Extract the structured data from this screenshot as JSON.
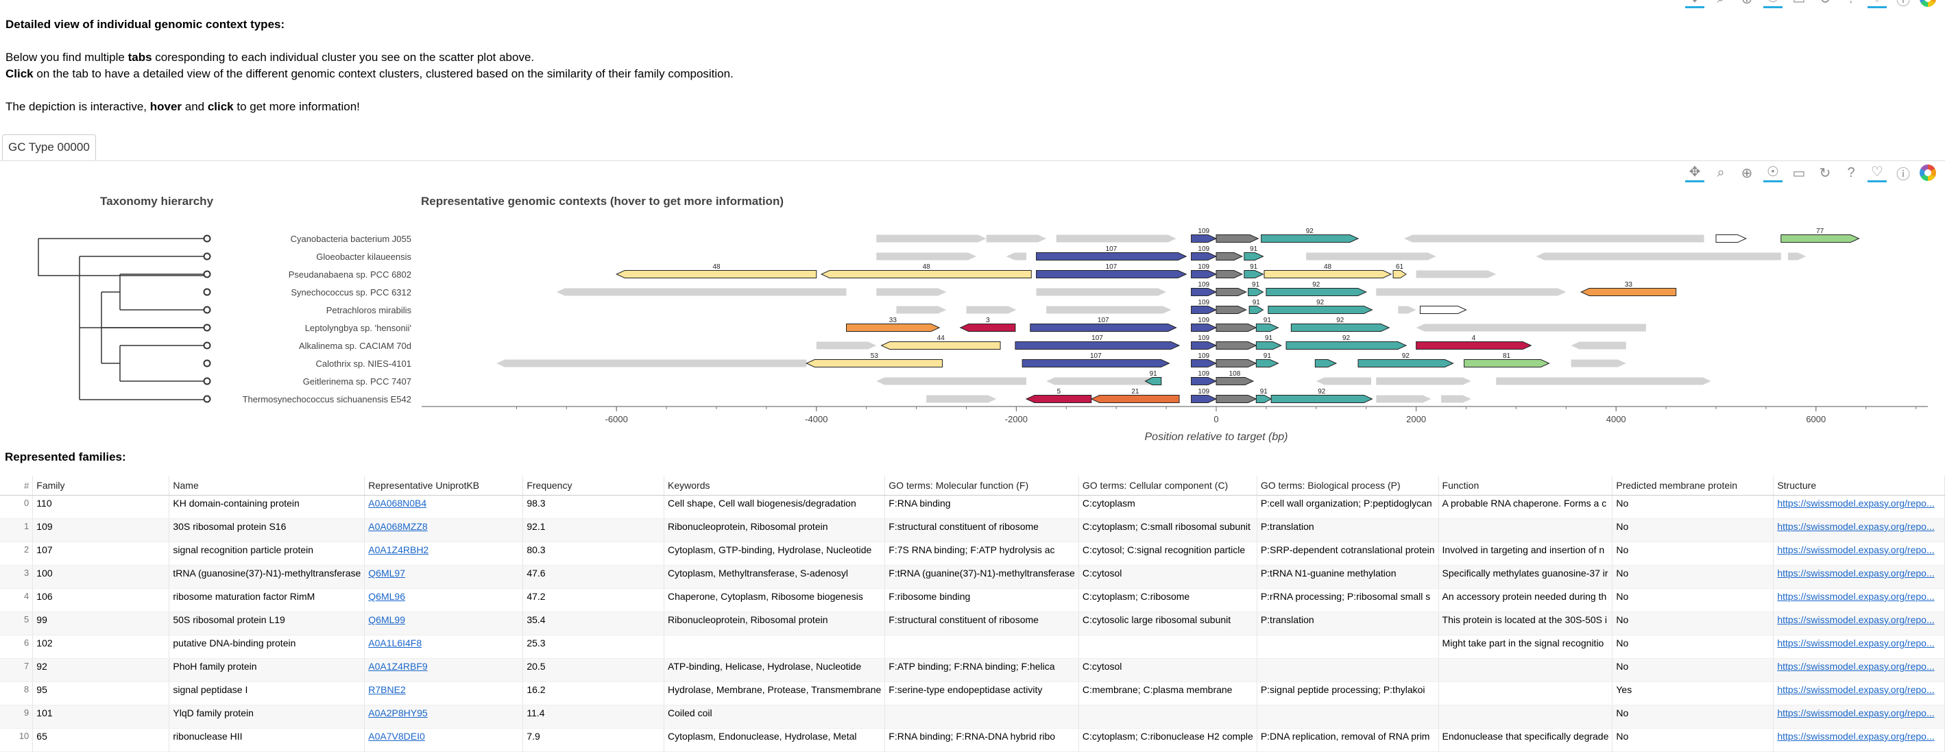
{
  "intro": {
    "title": "Detailed view of individual genomic context types:",
    "line1_pre": "Below you find multiple ",
    "line1_bold": "tabs",
    "line1_post": " coresponding to each individual cluster you see on the scatter plot above.",
    "line2_bold": "Click",
    "line2_post": " on the tab to have a detailed view of the different genomic context clusters, clustered based on the similarity of their family composition.",
    "line3_pre": "The depiction is interactive, ",
    "line3_b1": "hover",
    "line3_mid": " and ",
    "line3_b2": "click",
    "line3_post": " to get more information!"
  },
  "tab": {
    "label": "GC Type 00000"
  },
  "toolbar_icons": [
    "pan-icon",
    "box-zoom-icon",
    "wheel-zoom-icon",
    "tap-icon",
    "save-icon",
    "reset-icon",
    "help-icon",
    "hover-icon",
    "help2-icon",
    "bokeh-logo"
  ],
  "taxonomy": {
    "title": "Taxonomy hierarchy",
    "species": [
      "Cyanobacteria bacterium J055",
      "Gloeobacter kilaueensis",
      "Pseudanabaena sp. PCC 6802",
      "Synechococcus sp. PCC 6312",
      "Petrachloros mirabilis",
      "Leptolyngbya sp. 'hensonii'",
      "Alkalinema sp. CACIAM 70d",
      "Calothrix sp. NIES-4101",
      "Geitlerinema sp. PCC 7407",
      "Thermosynechococcus sichuanensis E542"
    ]
  },
  "contexts": {
    "title": "Representative genomic contexts (hover to get more information)",
    "xlabel": "Position relative to target (bp)",
    "xticks": [
      "-6000",
      "-4000",
      "-2000",
      "0",
      "2000",
      "4000",
      "6000"
    ],
    "colors": {
      "gray": "#d3d3d3",
      "target": "#4a55a8",
      "dark": "#7f7f7f",
      "teal": "#49ada6",
      "yellow": "#fbe59a",
      "orange": "#f29a4a",
      "crimson": "#c3184a",
      "green": "#9ad58a",
      "white": "#ffffff",
      "salmon": "#e8703a"
    }
  },
  "families_title": "Represented families:",
  "table": {
    "headers": [
      "#",
      "Family",
      "Name",
      "Representative UniprotKB",
      "Frequency",
      "Keywords",
      "GO terms: Molecular function (F)",
      "GO terms: Cellular component (C)",
      "GO terms: Biological process (P)",
      "Function",
      "Predicted membrane protein",
      "Structure"
    ],
    "rows": [
      [
        "0",
        "110",
        "KH domain-containing protein",
        "A0A068N0B4",
        "98.3",
        "Cell shape, Cell wall biogenesis/degradation",
        "F:RNA binding",
        "C:cytoplasm",
        "P:cell wall organization; P:peptidoglycan",
        "A probable RNA chaperone. Forms a c",
        "No",
        "https://swissmodel.expasy.org/repo..."
      ],
      [
        "1",
        "109",
        "30S ribosomal protein S16",
        "A0A068MZZ8",
        "92.1",
        "Ribonucleoprotein, Ribosomal protein",
        "F:structural constituent of ribosome",
        "C:cytoplasm; C:small ribosomal subunit",
        "P:translation",
        "",
        "No",
        "https://swissmodel.expasy.org/repo..."
      ],
      [
        "2",
        "107",
        "signal recognition particle protein",
        "A0A1Z4RBH2",
        "80.3",
        "Cytoplasm, GTP-binding, Hydrolase, Nucleotide",
        "F:7S RNA binding; F:ATP hydrolysis ac",
        "C:cytosol; C:signal recognition particle",
        "P:SRP-dependent cotranslational protein",
        "Involved in targeting and insertion of n",
        "No",
        "https://swissmodel.expasy.org/repo..."
      ],
      [
        "3",
        "100",
        "tRNA (guanosine(37)-N1)-methyltransferase",
        "Q6ML97",
        "47.6",
        "Cytoplasm, Methyltransferase, S-adenosyl",
        "F:tRNA (guanine(37)-N1)-methyltransferase",
        "C:cytosol",
        "P:tRNA N1-guanine methylation",
        "Specifically methylates guanosine-37 ir",
        "No",
        "https://swissmodel.expasy.org/repo..."
      ],
      [
        "4",
        "106",
        "ribosome maturation factor RimM",
        "Q6ML96",
        "47.2",
        "Chaperone, Cytoplasm, Ribosome biogenesis",
        "F:ribosome binding",
        "C:cytoplasm; C:ribosome",
        "P:rRNA processing; P:ribosomal small s",
        "An accessory protein needed during th",
        "No",
        "https://swissmodel.expasy.org/repo..."
      ],
      [
        "5",
        "99",
        "50S ribosomal protein L19",
        "Q6ML99",
        "35.4",
        "Ribonucleoprotein, Ribosomal protein",
        "F:structural constituent of ribosome",
        "C:cytosolic large ribosomal subunit",
        "P:translation",
        "This protein is located at the 30S-50S i",
        "No",
        "https://swissmodel.expasy.org/repo..."
      ],
      [
        "6",
        "102",
        "putative DNA-binding protein",
        "A0A1L6I4F8",
        "25.3",
        "",
        "",
        "",
        "",
        "Might take part in the signal recognitio",
        "No",
        "https://swissmodel.expasy.org/repo..."
      ],
      [
        "7",
        "92",
        "PhoH family protein",
        "A0A1Z4RBF9",
        "20.5",
        "ATP-binding, Helicase, Hydrolase, Nucleotide",
        "F:ATP binding; F:RNA binding; F:helica",
        "C:cytosol",
        "",
        "",
        "No",
        "https://swissmodel.expasy.org/repo..."
      ],
      [
        "8",
        "95",
        "signal peptidase I",
        "R7BNE2",
        "16.2",
        "Hydrolase, Membrane, Protease, Transmembrane",
        "F:serine-type endopeptidase activity",
        "C:membrane; C:plasma membrane",
        "P:signal peptide processing; P:thylakoi",
        "",
        "Yes",
        "https://swissmodel.expasy.org/repo..."
      ],
      [
        "9",
        "101",
        "YlqD family protein",
        "A0A2P8HY95",
        "11.4",
        "Coiled coil",
        "",
        "",
        "",
        "",
        "No",
        "https://swissmodel.expasy.org/repo..."
      ],
      [
        "10",
        "65",
        "ribonuclease HII",
        "A0A7V8DEI0",
        "7.9",
        "Cytoplasm, Endonuclease, Hydrolase, Metal",
        "F:RNA binding; F:RNA-DNA hybrid ribo",
        "C:cytoplasm; C:ribonuclease H2 comple",
        "P:DNA replication, removal of RNA prim",
        "Endonuclease that specifically degrade",
        "No",
        "https://swissmodel.expasy.org/repo..."
      ]
    ]
  }
}
